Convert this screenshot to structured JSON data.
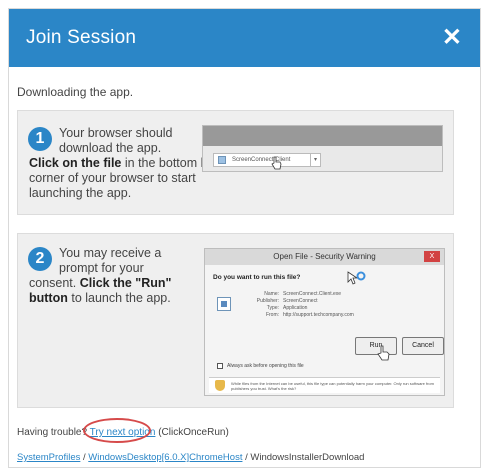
{
  "dialog": {
    "title": "Join Session",
    "close_glyph": "✕"
  },
  "intro": "Downloading the app.",
  "steps": [
    {
      "number": "1",
      "line1": "Your browser should",
      "line2": "download the app.",
      "bold": "Click on the file",
      "rest": " in the bottom left corner of your browser to start launching the app."
    },
    {
      "number": "2",
      "line1": "You may receive a",
      "line2": "prompt for your",
      "pre": "consent. ",
      "bold": "Click the \"Run\" button",
      "rest": " to launch the app."
    }
  ],
  "browser_mock": {
    "download_name": "ScreenConnect.Client",
    "arrow": "▾"
  },
  "security_mock": {
    "title": "Open File - Security Warning",
    "close": "X",
    "question": "Do you want to run this file?",
    "fields": [
      {
        "k": "Name:",
        "v": "ScreenConnect.Client.exe"
      },
      {
        "k": "Publisher:",
        "v": "ScreenConnect"
      },
      {
        "k": "Type:",
        "v": "Application"
      },
      {
        "k": "From:",
        "v": "http://support.techcompany.com"
      }
    ],
    "run_label": "Run",
    "cancel_label": "Cancel",
    "checkbox_label": "Always ask before opening this file",
    "warning": "While files from the Internet can be useful, this file type can potentially harm your computer. Only run software from publishers you trust. What's the risk?"
  },
  "trouble": {
    "prefix": "Having trouble? ",
    "link": "Try next option",
    "suffix": " (ClickOnceRun)"
  },
  "breadcrumbs": {
    "item1": "SystemProfiles",
    "item2": "WindowsDesktop[6.0.X]ChromeHost",
    "item3": "WindowsInstallerDownload",
    "sep": " / "
  },
  "colors": {
    "accent": "#2b86c7",
    "highlight_circle": "#d64a4a"
  }
}
